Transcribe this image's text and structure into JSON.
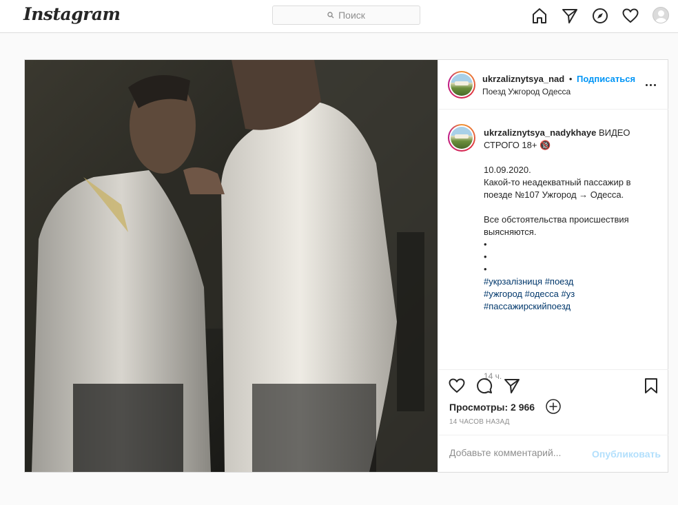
{
  "app": {
    "logo": "Instagram"
  },
  "search": {
    "placeholder": "Поиск",
    "icon": "search-icon"
  },
  "nav": {
    "icons": [
      "home-icon",
      "direct-icon",
      "explore-icon",
      "heart-icon",
      "profile-avatar"
    ]
  },
  "post": {
    "media": {
      "description_icon": "video"
    },
    "header": {
      "username": "ukrzaliznytsya_nad",
      "separator": "•",
      "follow_label": "Подписаться",
      "location": "Поезд Ужгород Одесса"
    },
    "caption": {
      "username": "ukrzaliznytsya_nadykhaye",
      "title": "ВИДЕО СТРОГО 18+ 🔞",
      "date": "10.09.2020.",
      "text1": "Какой-то неадекватный пассажир в поезде №107 Ужгород → Одесса.",
      "text2": "Все обстоятельства происшествия выясняются.",
      "bullets": [
        "•",
        "•",
        "•"
      ],
      "tags_line1": [
        "#укрзалізниця",
        "#поезд"
      ],
      "tags_line2": [
        "#ужгород",
        "#одесса",
        "#уз"
      ],
      "tags_line3": [
        "#пассажирскийпоезд"
      ],
      "time": "14 ч."
    },
    "actions": {
      "views_label": "Просмотры: 2 966",
      "time_ago": "14 ЧАСОВ НАЗАД",
      "comment_placeholder": "Добавьте комментарий...",
      "publish_label": "Опубликовать"
    }
  },
  "colors": {
    "accent": "#0095f6",
    "tag": "#00376b",
    "muted": "#8e8e8e",
    "border": "#dbdbdb"
  }
}
